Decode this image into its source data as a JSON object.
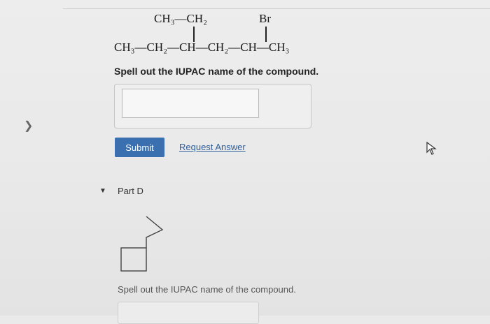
{
  "question": {
    "formula": {
      "top_left": "CH₃—CH₂",
      "top_right": "Br",
      "main_chain": "CH₃—CH₂—CH—CH₂—CH—CH₃"
    },
    "prompt": "Spell out the IUPAC name of the compound.",
    "answer_value": "",
    "submit_label": "Submit",
    "request_answer_label": "Request Answer"
  },
  "part_d": {
    "label": "Part D",
    "prompt": "Spell out the IUPAC name of the compound.",
    "answer_value": ""
  },
  "colors": {
    "submit_bg": "#3a6fb0",
    "link": "#2f5f9b"
  },
  "icons": {
    "nav": "chevron-right-icon",
    "cursor": "mouse-pointer-icon",
    "collapse": "caret-down-icon"
  }
}
